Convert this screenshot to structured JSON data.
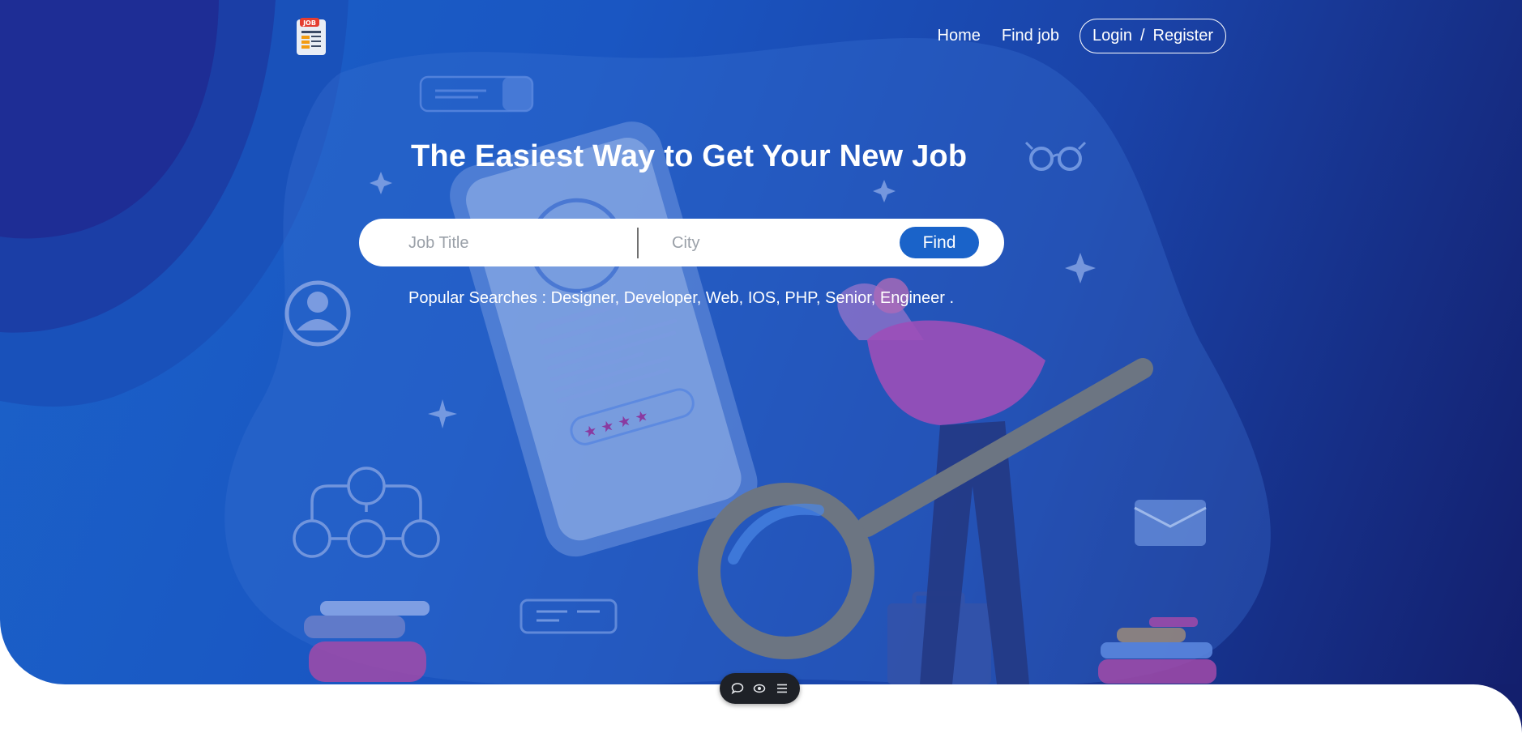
{
  "logo": {
    "badge_text": "JOB",
    "icon": "job-document-logo-icon"
  },
  "nav": {
    "home": "Home",
    "find_job": "Find job",
    "login": "Login",
    "separator": "/",
    "register": "Register"
  },
  "hero": {
    "headline": "The Easiest Way to Get Your New Job"
  },
  "search": {
    "job_placeholder": "Job Title",
    "job_value": "",
    "city_placeholder": "City",
    "city_value": "",
    "find_label": "Find"
  },
  "popular": {
    "label": "Popular Searches :",
    "tags": [
      "Designer,",
      "Developer,",
      "Web,",
      "IOS,",
      "PHP,",
      "Senior,",
      "Engineer ."
    ]
  },
  "toolbar": {
    "icons": [
      "chat-icon",
      "eye-icon",
      "menu-icon"
    ]
  },
  "colors": {
    "hero_gradient_start": "#1b62c9",
    "hero_gradient_end": "#131f6d",
    "find_button": "#1a63c9",
    "toolbar_bg": "#1e2127"
  }
}
